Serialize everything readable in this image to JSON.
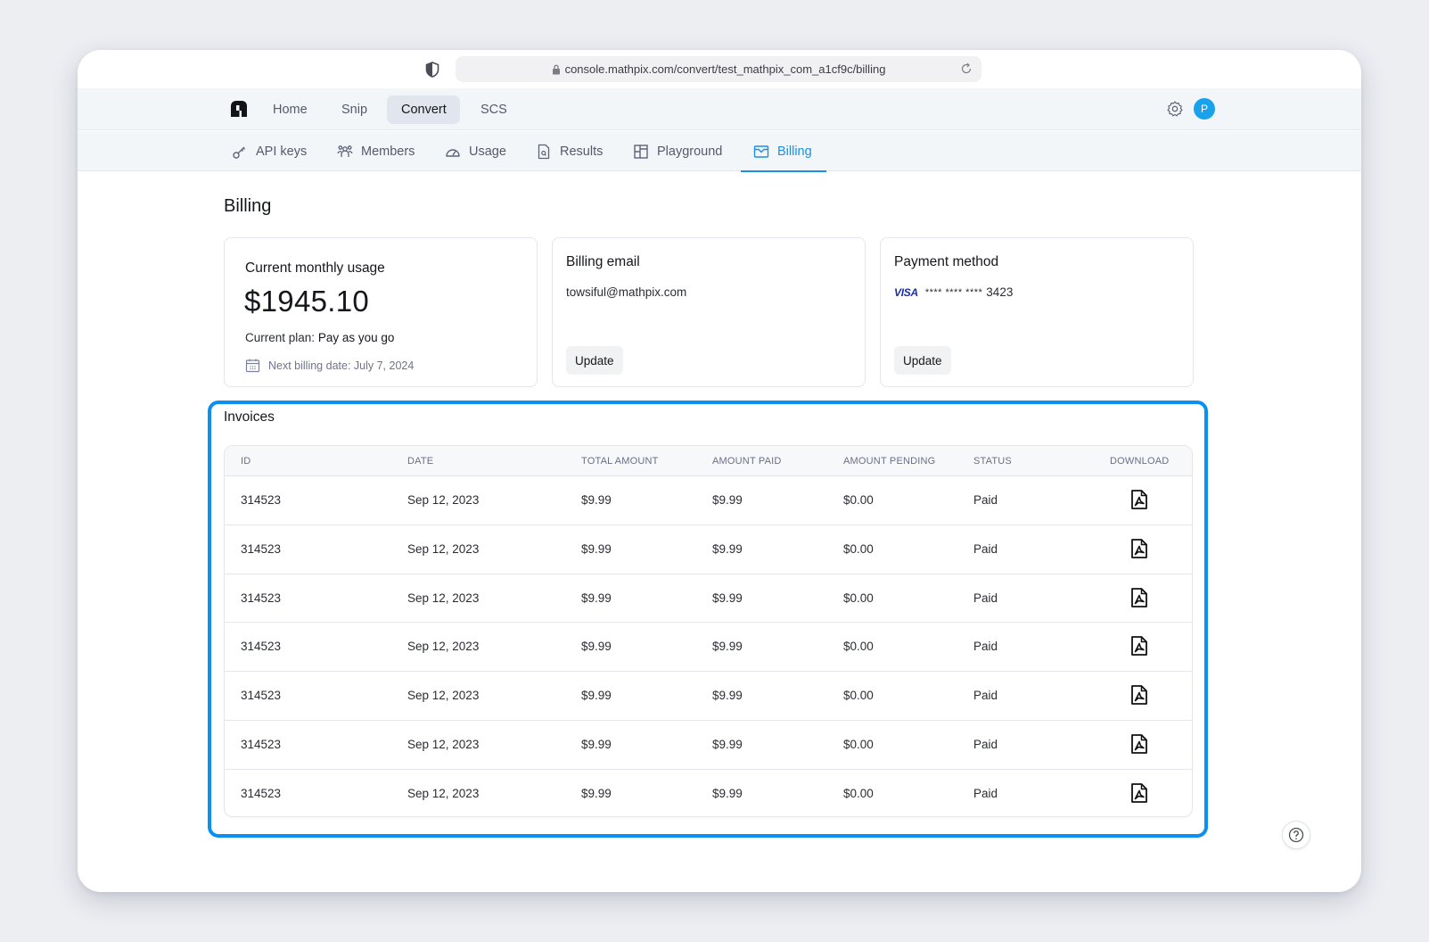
{
  "browser": {
    "url": "console.mathpix.com/convert/test_mathpix_com_a1cf9c/billing"
  },
  "topnav": {
    "items": [
      {
        "label": "Home",
        "active": false
      },
      {
        "label": "Snip",
        "active": false
      },
      {
        "label": "Convert",
        "active": true
      },
      {
        "label": "SCS",
        "active": false
      }
    ],
    "avatar_initial": "P"
  },
  "subnav": {
    "items": [
      {
        "label": "API keys",
        "icon": "key-icon",
        "active": false
      },
      {
        "label": "Members",
        "icon": "members-icon",
        "active": false
      },
      {
        "label": "Usage",
        "icon": "gauge-icon",
        "active": false
      },
      {
        "label": "Results",
        "icon": "file-search-icon",
        "active": false
      },
      {
        "label": "Playground",
        "icon": "layout-icon",
        "active": false
      },
      {
        "label": "Billing",
        "icon": "billing-icon",
        "active": true
      }
    ]
  },
  "page": {
    "title": "Billing"
  },
  "usage_card": {
    "title": "Current monthly usage",
    "amount": "$1945.10",
    "plan_label": "Current plan:",
    "plan_value": "Pay as you go",
    "next_billing": "Next billing date: July 7, 2024"
  },
  "email_card": {
    "title": "Billing email",
    "email": "towsiful@mathpix.com",
    "button": "Update"
  },
  "payment_card": {
    "title": "Payment method",
    "brand": "VISA",
    "masked": "**** **** ****",
    "last4": "3423",
    "button": "Update"
  },
  "invoices": {
    "title": "Invoices",
    "columns": [
      "ID",
      "DATE",
      "TOTAL AMOUNT",
      "AMOUNT PAID",
      "AMOUNT PENDING",
      "STATUS",
      "DOWNLOAD"
    ],
    "rows": [
      {
        "id": "314523",
        "date": "Sep 12, 2023",
        "total": "$9.99",
        "paid": "$9.99",
        "pending": "$0.00",
        "status": "Paid"
      },
      {
        "id": "314523",
        "date": "Sep 12, 2023",
        "total": "$9.99",
        "paid": "$9.99",
        "pending": "$0.00",
        "status": "Paid"
      },
      {
        "id": "314523",
        "date": "Sep 12, 2023",
        "total": "$9.99",
        "paid": "$9.99",
        "pending": "$0.00",
        "status": "Paid"
      },
      {
        "id": "314523",
        "date": "Sep 12, 2023",
        "total": "$9.99",
        "paid": "$9.99",
        "pending": "$0.00",
        "status": "Paid"
      },
      {
        "id": "314523",
        "date": "Sep 12, 2023",
        "total": "$9.99",
        "paid": "$9.99",
        "pending": "$0.00",
        "status": "Paid"
      },
      {
        "id": "314523",
        "date": "Sep 12, 2023",
        "total": "$9.99",
        "paid": "$9.99",
        "pending": "$0.00",
        "status": "Paid"
      },
      {
        "id": "314523",
        "date": "Sep 12, 2023",
        "total": "$9.99",
        "paid": "$9.99",
        "pending": "$0.00",
        "status": "Paid"
      }
    ]
  },
  "colors": {
    "accent": "#1a8fe6",
    "highlight": "#0b8ff0",
    "avatar": "#1aa1ec",
    "visa": "#1a2fa8"
  }
}
